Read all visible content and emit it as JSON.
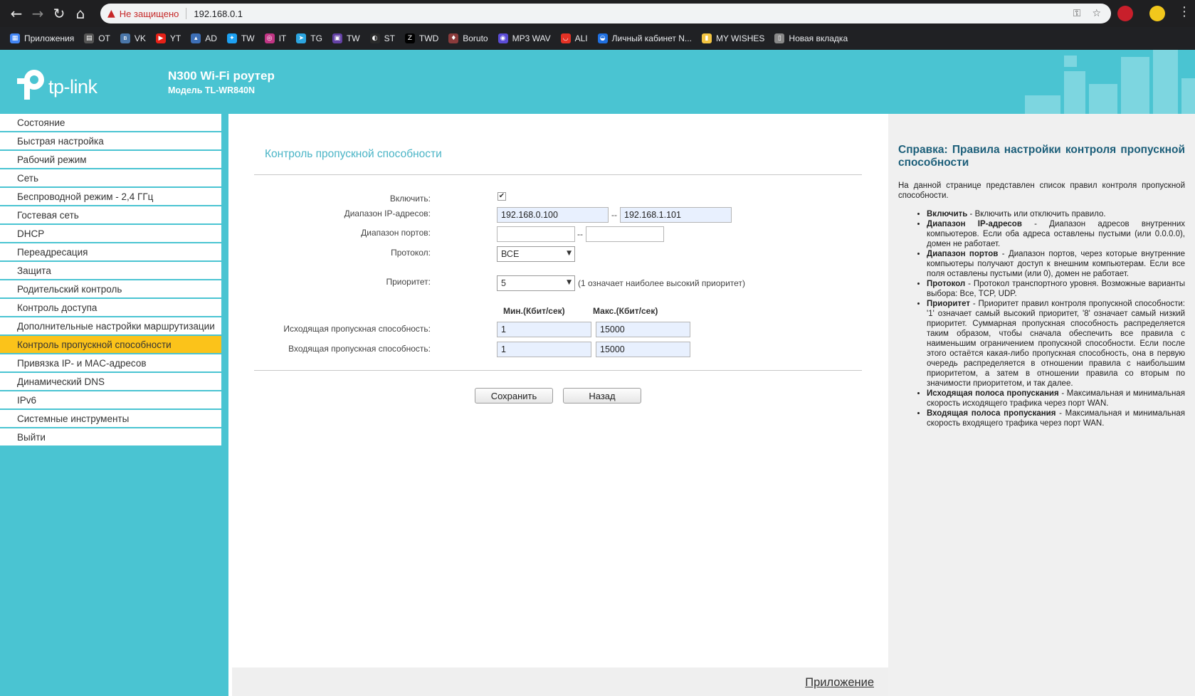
{
  "browser": {
    "security_label": "Не защищено",
    "url": "192.168.0.1",
    "bookmarks": [
      {
        "label": "Приложения",
        "color": "#4285f4",
        "glyph": "▦"
      },
      {
        "label": "OT",
        "color": "#555555",
        "glyph": "▤"
      },
      {
        "label": "VK",
        "color": "#4a76a8",
        "glyph": "в"
      },
      {
        "label": "YT",
        "color": "#e62117",
        "glyph": "▶"
      },
      {
        "label": "AD",
        "color": "#3d6fb6",
        "glyph": "▴"
      },
      {
        "label": "TW",
        "color": "#1da1f2",
        "glyph": "✦"
      },
      {
        "label": "IT",
        "color": "#c13584",
        "glyph": "◎"
      },
      {
        "label": "TG",
        "color": "#2ca5e0",
        "glyph": "➤"
      },
      {
        "label": "TW",
        "color": "#6441a5",
        "glyph": "▣"
      },
      {
        "label": "ST",
        "color": "#2a2a2a",
        "glyph": "◐"
      },
      {
        "label": "TWD",
        "color": "#000000",
        "glyph": "Z"
      },
      {
        "label": "Boruto",
        "color": "#8a3b3b",
        "glyph": "♦"
      },
      {
        "label": "MP3 WAV",
        "color": "#5b4cd6",
        "glyph": "◉"
      },
      {
        "label": "ALI",
        "color": "#e43225",
        "glyph": "◡"
      },
      {
        "label": "Личный кабинет N...",
        "color": "#1f6fe0",
        "glyph": "◒"
      },
      {
        "label": "MY WISHES",
        "color": "#f4c542",
        "glyph": "▮"
      },
      {
        "label": "Новая вкладка",
        "color": "#888888",
        "glyph": "▯"
      }
    ]
  },
  "header": {
    "logo_text": "tp-link",
    "model_title": "N300 Wi-Fi роутер",
    "model_subtitle": "Модель TL-WR840N"
  },
  "sidebar": {
    "items": [
      {
        "label": "Состояние"
      },
      {
        "label": "Быстрая настройка"
      },
      {
        "label": "Рабочий режим"
      },
      {
        "label": "Сеть"
      },
      {
        "label": "Беспроводной режим - 2,4 ГГц"
      },
      {
        "label": "Гостевая сеть"
      },
      {
        "label": "DHCP"
      },
      {
        "label": "Переадресация"
      },
      {
        "label": "Защита"
      },
      {
        "label": "Родительский контроль"
      },
      {
        "label": "Контроль доступа"
      },
      {
        "label": "Дополнительные настройки маршрутизации"
      },
      {
        "label": "Контроль пропускной способности"
      },
      {
        "label": "Привязка IP- и MAC-адресов"
      },
      {
        "label": "Динамический DNS"
      },
      {
        "label": "IPv6"
      },
      {
        "label": "Системные инструменты"
      },
      {
        "label": "Выйти"
      }
    ],
    "active_index": 12
  },
  "main": {
    "title": "Контроль пропускной способности",
    "form": {
      "enable_label": "Включить:",
      "enable_checked": true,
      "ip_range_label": "Диапазон IP-адресов:",
      "ip_start": "192.168.0.100",
      "ip_end": "192.168.1.101",
      "range_separator": "--",
      "port_range_label": "Диапазон портов:",
      "port_start": "",
      "port_end": "",
      "protocol_label": "Протокол:",
      "protocol_value": "ВСЕ",
      "priority_label": "Приоритет:",
      "priority_value": "5",
      "priority_hint": "(1 означает наиболее высокий приоритет)",
      "min_header": "Мин.(Кбит/сек)",
      "max_header": "Макс.(Кбит/сек)",
      "egress_label": "Исходящая пропускная способность:",
      "egress_min": "1",
      "egress_max": "15000",
      "ingress_label": "Входящая пропускная способность:",
      "ingress_min": "1",
      "ingress_max": "15000"
    },
    "save_button": "Сохранить",
    "back_button": "Назад",
    "app_link": "Приложение"
  },
  "help": {
    "title": "Справка: Правила настройки контроля пропускной способности",
    "intro": "На данной странице представлен список правил контроля пропускной способности.",
    "items": [
      {
        "term": "Включить",
        "text": " - Включить или отключить правило."
      },
      {
        "term": "Диапазон IP-адресов",
        "text": " - Диапазон адресов внутренних компьютеров. Если оба адреса оставлены пустыми (или 0.0.0.0), домен не работает."
      },
      {
        "term": "Диапазон портов",
        "text": " - Диапазон портов, через которые внутренние компьютеры получают доступ к внешним компьютерам. Если все поля оставлены пустыми (или 0), домен не работает."
      },
      {
        "term": "Протокол",
        "text": " - Протокол транспортного уровня. Возможные варианты выбора: Все, TCP, UDP."
      },
      {
        "term": "Приоритет",
        "text": " - Приоритет правил контроля пропускной способности: '1' означает самый высокий приоритет, '8' означает самый низкий приоритет. Суммарная пропускная способность распределяется таким образом, чтобы сначала обеспечить все правила с наименьшим ограничением пропускной способности. Если после этого остаётся какая-либо пропускная способность, она в первую очередь распределяется в отношении правила с наибольшим приоритетом, а затем в отношении правила со вторым по значимости приоритетом, и так далее."
      },
      {
        "term": "Исходящая полоса пропускания",
        "text": " - Максимальная и минимальная скорость исходящего трафика через порт WAN."
      },
      {
        "term": "Входящая полоса пропускания",
        "text": " - Максимальная и минимальная скорость входящего трафика через порт WAN."
      }
    ]
  }
}
